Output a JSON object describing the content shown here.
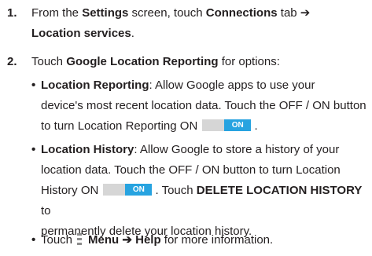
{
  "steps": [
    {
      "number": "1.",
      "parts": [
        "From the ",
        "Settings",
        " screen, touch ",
        "Connections",
        " tab ➔",
        "Location services",
        "."
      ]
    },
    {
      "number": "2.",
      "parts": [
        "Touch ",
        "Google Location Reporting",
        " for options:"
      ]
    }
  ],
  "bullets": {
    "reporting": {
      "marker": "•",
      "title": "Location Reporting",
      "line1": ": Allow Google apps to use your",
      "line2": "device's most recent location data. Touch the OFF / ON button",
      "line3": "to turn Location Reporting ON",
      "end": "."
    },
    "history": {
      "marker": "•",
      "title": "Location History",
      "line1": ": Allow Google to store a history of your",
      "line2": "location data. Touch the OFF / ON button to turn Location",
      "line3_a": "History ON",
      "line3_b": ". Touch ",
      "line3_bold": "DELETE LOCATION HISTORY",
      "line3_c": " to",
      "line4": "permanently delete your location history."
    },
    "menu": {
      "marker": "•",
      "touch": "Touch",
      "menu_label": "Menu",
      "arrow_help": " ➔ Help",
      "rest": " for more information."
    }
  },
  "toggle_label": "ON",
  "colors": {
    "toggle_on": "#27a3e0",
    "toggle_off": "#d6d6d6",
    "menu_icon": "#8c8c8c"
  }
}
